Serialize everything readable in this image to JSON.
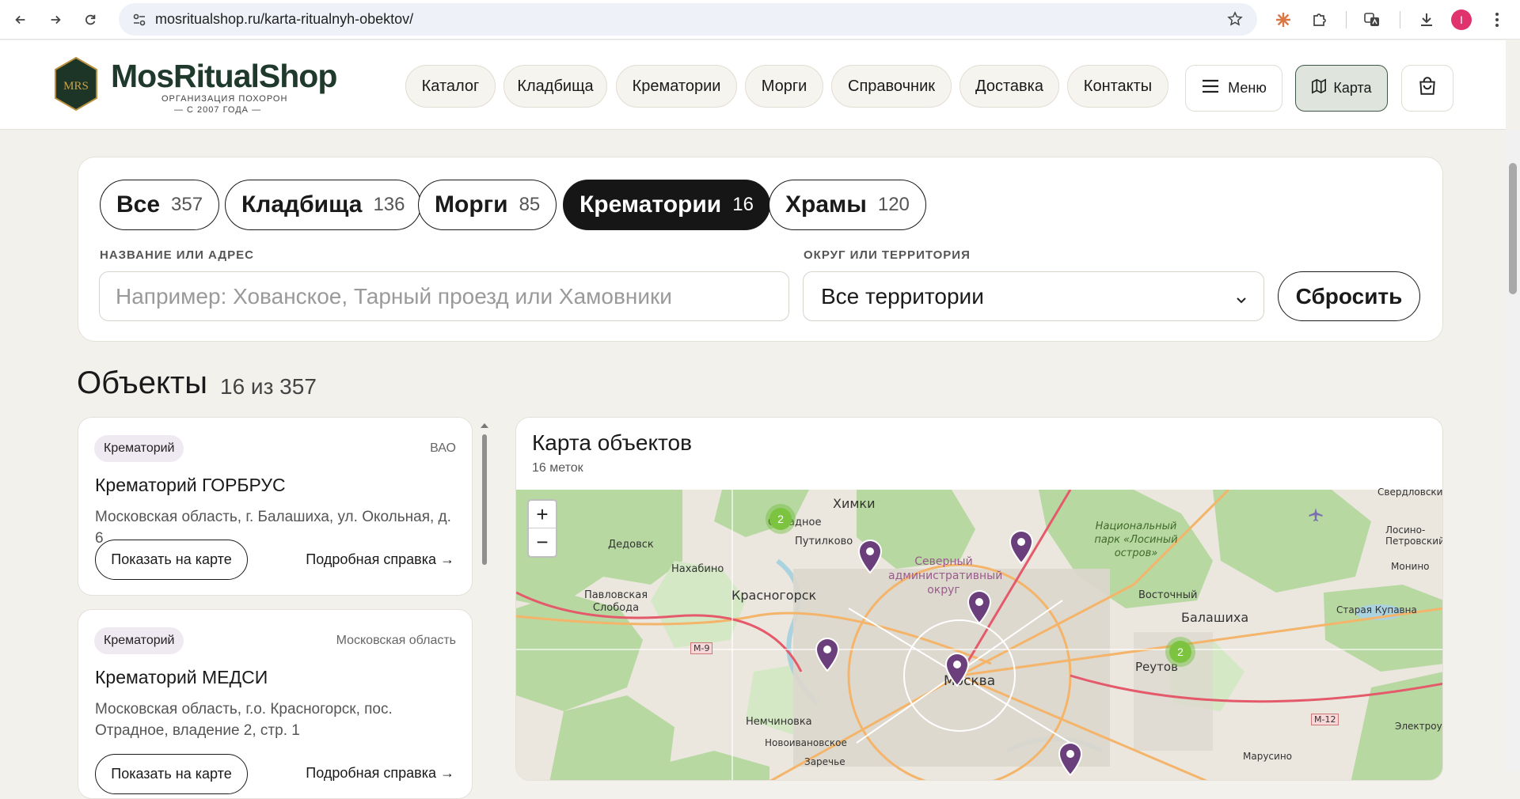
{
  "browser": {
    "url": "mosritualshop.ru/karta-ritualnyh-obektov/",
    "avatar_letter": "I"
  },
  "site": {
    "logo_title": "MosRitualShop",
    "logo_sub": "ОРГАНИЗАЦИЯ ПОХОРОН",
    "logo_sub2": "— С 2007 ГОДА —",
    "logo_mark_text": "MRS",
    "nav": [
      "Каталог",
      "Кладбища",
      "Крематории",
      "Морги",
      "Справочник",
      "Доставка",
      "Контакты"
    ],
    "menu_label": "Меню",
    "map_label": "Карта"
  },
  "filters": {
    "chips": [
      {
        "label": "Все",
        "count": "357"
      },
      {
        "label": "Кладбища",
        "count": "136"
      },
      {
        "label": "Морги",
        "count": "85"
      },
      {
        "label": "Крематории",
        "count": "16",
        "active": true
      },
      {
        "label": "Храмы",
        "count": "120"
      }
    ],
    "name_label": "НАЗВАНИЕ ИЛИ АДРЕС",
    "name_placeholder": "Например: Хованское, Тарный проезд или Хамовники",
    "district_label": "ОКРУГ ИЛИ ТЕРРИТОРИЯ",
    "district_value": "Все территории",
    "reset_label": "Сбросить"
  },
  "objects": {
    "title": "Объекты",
    "count": "16 из 357",
    "items": [
      {
        "badge": "Крематорий",
        "region": "ВАО",
        "title": "Крематорий ГОРБРУС",
        "address": "Московская область, г. Балашиха, ул. Окольная, д. 6",
        "show_label": "Показать на карте",
        "more_label": "Подробная справка →"
      },
      {
        "badge": "Крематорий",
        "region": "Московская область",
        "title": "Крематорий МЕДСИ",
        "address": "Московская область, г.о. Красногорск, пос. Отрадное, владение 2, стр. 1",
        "show_label": "Показать на карте",
        "more_label": "Подробная справка →"
      }
    ]
  },
  "map": {
    "title": "Карта объектов",
    "subtitle": "16 меток",
    "zoom_in": "+",
    "zoom_out": "−",
    "labels": [
      "Химки",
      "Отрадное",
      "Путилково",
      "Дедовск",
      "Нахабино",
      "Павловская Слобода",
      "Красногорск",
      "Северный административный округ",
      "Национальный парк «Лосиный остров»",
      "Свердловский",
      "Лосино-Петровский",
      "Монино",
      "Восточный",
      "Балашиха",
      "Старая Купавна",
      "Реутов",
      "Москва",
      "Немчиновка",
      "Новоивановское",
      "Заречье",
      "Марусино",
      "Электроугли",
      "М-9",
      "М-12"
    ],
    "clusters": [
      "2",
      "2"
    ],
    "pin_color": "#6b3f7c",
    "cluster_color": "#7cc33f"
  }
}
